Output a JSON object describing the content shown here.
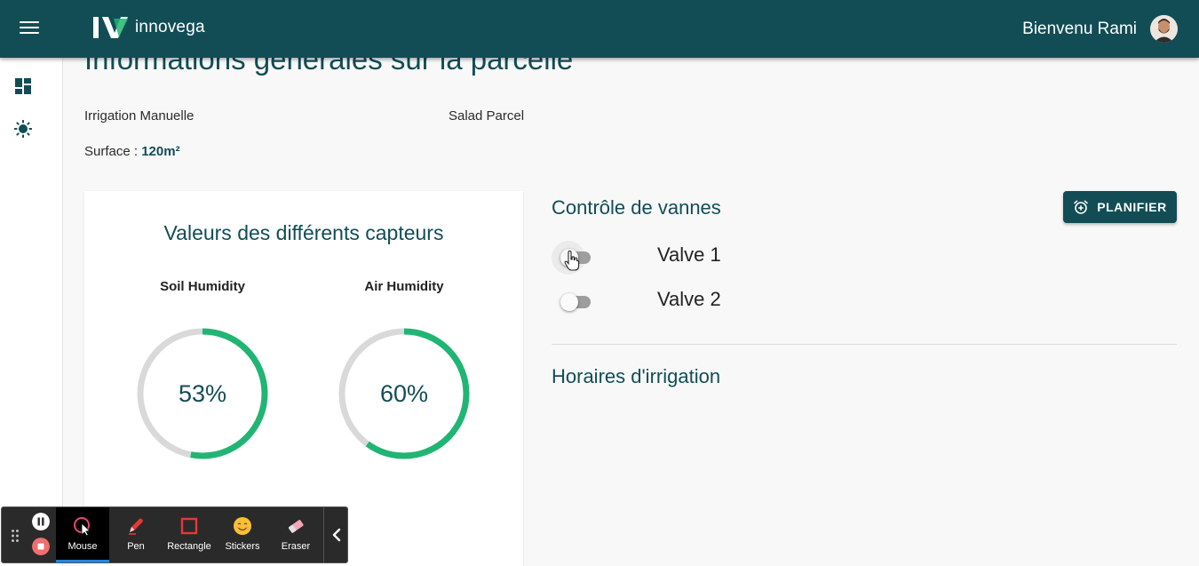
{
  "header": {
    "brand": "innovega",
    "greeting": "Bienvenu Rami",
    "accent_color": "#124d56"
  },
  "sidebar": {
    "items": [
      {
        "icon": "dashboard-icon"
      },
      {
        "icon": "sun-icon"
      }
    ]
  },
  "main": {
    "title": "Informations générales sur la parcelle",
    "irrigation_mode": "Irrigation Manuelle",
    "parcel_name": "Salad Parcel",
    "surface_label": "Surface :",
    "surface_value": "120m²"
  },
  "sensors": {
    "title": "Valeurs des différents capteurs",
    "gauges": [
      {
        "label": "Soil Humidity",
        "value": 53,
        "display": "53%"
      },
      {
        "label": "Air Humidity",
        "value": 60,
        "display": "60%"
      }
    ],
    "gauge_color": "#21b573",
    "track_color": "#d9d9d9"
  },
  "valves": {
    "title": "Contrôle de vannes",
    "button_label": "PLANIFIER",
    "items": [
      {
        "label": "Valve 1",
        "on": false
      },
      {
        "label": "Valve 2",
        "on": false
      }
    ]
  },
  "schedule": {
    "title": "Horaires d'irrigation"
  },
  "recorder": {
    "tools": [
      {
        "label": "Mouse",
        "active": true
      },
      {
        "label": "Pen",
        "active": false
      },
      {
        "label": "Rectangle",
        "active": false
      },
      {
        "label": "Stickers",
        "active": false
      },
      {
        "label": "Eraser",
        "active": false
      }
    ]
  }
}
